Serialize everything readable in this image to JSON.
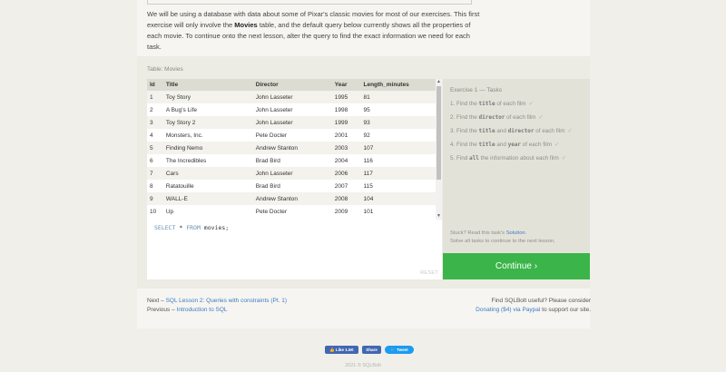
{
  "intro": {
    "part1": "We will be using a database with data about some of Pixar's classic movies for most of our exercises. This first exercise will only involve the ",
    "bold": "Movies",
    "part2": " table, and the default query below currently shows all the properties of each movie. To continue onto the next lesson, alter the query to find the exact information we need for each task."
  },
  "table": {
    "caption": "Table: Movies",
    "headers": [
      "Id",
      "Title",
      "Director",
      "Year",
      "Length_minutes"
    ],
    "rows": [
      [
        "1",
        "Toy Story",
        "John Lasseter",
        "1995",
        "81"
      ],
      [
        "2",
        "A Bug's Life",
        "John Lasseter",
        "1998",
        "95"
      ],
      [
        "3",
        "Toy Story 2",
        "John Lasseter",
        "1999",
        "93"
      ],
      [
        "4",
        "Monsters, Inc.",
        "Pete Docter",
        "2001",
        "92"
      ],
      [
        "5",
        "Finding Nemo",
        "Andrew Stanton",
        "2003",
        "107"
      ],
      [
        "6",
        "The Incredibles",
        "Brad Bird",
        "2004",
        "116"
      ],
      [
        "7",
        "Cars",
        "John Lasseter",
        "2006",
        "117"
      ],
      [
        "8",
        "Ratatouille",
        "Brad Bird",
        "2007",
        "115"
      ],
      [
        "9",
        "WALL-E",
        "Andrew Stanton",
        "2008",
        "104"
      ],
      [
        "10",
        "Up",
        "Pete Docter",
        "2009",
        "101"
      ]
    ]
  },
  "editor": {
    "kw1": "SELECT",
    "star": " * ",
    "kw2": "FROM",
    "rest": " movies;",
    "reset_label": "RESET"
  },
  "tasks": {
    "title": "Exercise 1 — Tasks",
    "items": [
      {
        "pre": "1. Find the ",
        "code1": "title",
        "mid": " of each film",
        "code2": "",
        "post": ""
      },
      {
        "pre": "2. Find the ",
        "code1": "director",
        "mid": " of each film",
        "code2": "",
        "post": ""
      },
      {
        "pre": "3. Find the ",
        "code1": "title",
        "mid": " and ",
        "code2": "director",
        "post": " of each film"
      },
      {
        "pre": "4. Find the ",
        "code1": "title",
        "mid": " and ",
        "code2": "year",
        "post": " of each film"
      },
      {
        "pre": "5. Find ",
        "code1": "all",
        "mid": " the information about each film",
        "code2": "",
        "post": ""
      }
    ],
    "check": "✓",
    "stuck_prefix": "Stuck? Read this task's ",
    "stuck_link": "Solution",
    "stuck_suffix": ".",
    "stuck_line2": "Solve all tasks to continue to the next lesson."
  },
  "continue_label": "Continue ›",
  "nav": {
    "next_prefix": "Next – ",
    "next_link": "SQL Lesson 2: Queries with constraints (Pt. 1)",
    "prev_prefix": "Previous – ",
    "prev_link": "Introduction to SQL",
    "useful": "Find SQLBolt useful? Please consider",
    "donate_link": "Donating ($4) via Paypal",
    "donate_suffix": " to support our site."
  },
  "social": {
    "like": "👍 Like 1.5K",
    "share": "Share",
    "tweet": "🐦 Tweet"
  },
  "footer": "2021 © SQLBolt",
  "colors": {
    "continue": "#3bb54a",
    "link": "#3d7cc0",
    "header_bg": "#dddcd2"
  }
}
